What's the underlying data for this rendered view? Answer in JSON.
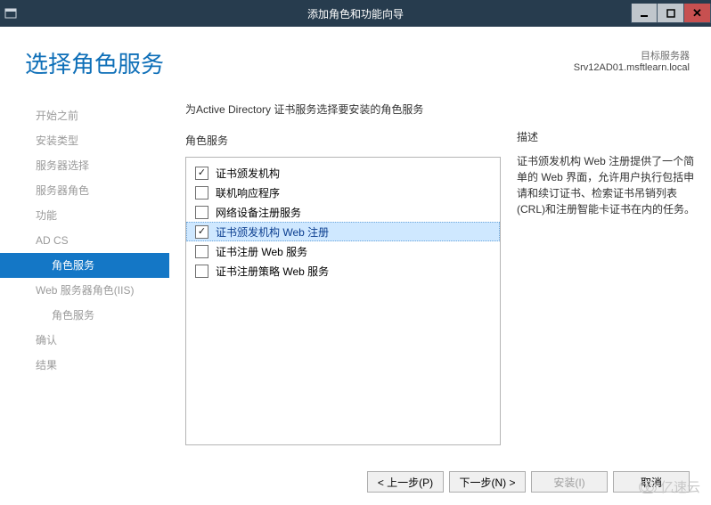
{
  "window": {
    "title": "添加角色和功能向导"
  },
  "header": {
    "page_title": "选择角色服务",
    "target_label": "目标服务器",
    "target_server": "Srv12AD01.msftlearn.local"
  },
  "sidebar": {
    "items": [
      {
        "label": "开始之前",
        "level": 1,
        "active": false
      },
      {
        "label": "安装类型",
        "level": 1,
        "active": false
      },
      {
        "label": "服务器选择",
        "level": 1,
        "active": false
      },
      {
        "label": "服务器角色",
        "level": 1,
        "active": false
      },
      {
        "label": "功能",
        "level": 1,
        "active": false
      },
      {
        "label": "AD CS",
        "level": 1,
        "active": false
      },
      {
        "label": "角色服务",
        "level": 2,
        "active": true
      },
      {
        "label": "Web 服务器角色(IIS)",
        "level": 1,
        "active": false
      },
      {
        "label": "角色服务",
        "level": 2,
        "active": false
      },
      {
        "label": "确认",
        "level": 1,
        "active": false
      },
      {
        "label": "结果",
        "level": 1,
        "active": false
      }
    ]
  },
  "main": {
    "instruction": "为Active Directory 证书服务选择要安装的角色服务",
    "roles_label": "角色服务",
    "roles": [
      {
        "label": "证书颁发机构",
        "checked": true,
        "selected": false
      },
      {
        "label": "联机响应程序",
        "checked": false,
        "selected": false
      },
      {
        "label": "网络设备注册服务",
        "checked": false,
        "selected": false
      },
      {
        "label": "证书颁发机构 Web 注册",
        "checked": true,
        "selected": true
      },
      {
        "label": "证书注册 Web 服务",
        "checked": false,
        "selected": false
      },
      {
        "label": "证书注册策略 Web 服务",
        "checked": false,
        "selected": false
      }
    ],
    "desc_label": "描述",
    "desc_text": "证书颁发机构 Web 注册提供了一个简单的 Web 界面，允许用户执行包括申请和续订证书、检索证书吊销列表(CRL)和注册智能卡证书在内的任务。"
  },
  "footer": {
    "prev": "< 上一步(P)",
    "next": "下一步(N) >",
    "install": "安装(I)",
    "cancel": "取消"
  },
  "watermark": "亿速云"
}
